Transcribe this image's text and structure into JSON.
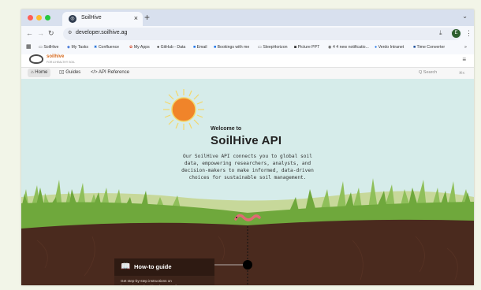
{
  "browser": {
    "tab_title": "SoilHive",
    "tab_close": "×",
    "new_tab": "+",
    "tab_list": "⌄",
    "url": "developer.soilhive.ag",
    "profile_initial": "E",
    "window_dot_colors": [
      "#ff5f57",
      "#febc2e",
      "#28c840"
    ],
    "bookmarks": [
      "SoilHive",
      "My Tasks",
      "Confluence",
      "My Apps",
      "GitHub - Data",
      "Email",
      "Bookings with me",
      "SleepHorizon",
      "Picture PPT",
      "4 4 new notificatio...",
      "Verdo Intranet",
      "Time Converter"
    ],
    "bookmarks_more": "»"
  },
  "site": {
    "logo_text": "soilhive",
    "logo_tagline": "FOR A HEALTHY SOIL",
    "menu_icon": "≡"
  },
  "doc_nav": {
    "tabs": [
      "Home",
      "Guides",
      "API Reference"
    ],
    "active_tab": "Home",
    "search_placeholder": "Q Search",
    "shortcut": "⌘K"
  },
  "hero": {
    "welcome": "Welcome to",
    "title": "SoilHive API",
    "description": "Our SoilHive API connects you to global soil\ndata, empowering researchers, analysts, and\ndecision-makers to make informed, data-driven\nchoices for sustainable soil management.",
    "colors": {
      "sky": "#d6ecea",
      "grass_back": "#c7d89a",
      "grass_front": "#6fa83c",
      "soil": "#4a2a1e",
      "sun": "#f0842a",
      "worm": "#e06a73"
    }
  },
  "cards": [
    {
      "icon": "book-icon",
      "title": "How-to guide",
      "body": "Get step-by-step instructions on\nintegrating and making the most of"
    }
  ]
}
